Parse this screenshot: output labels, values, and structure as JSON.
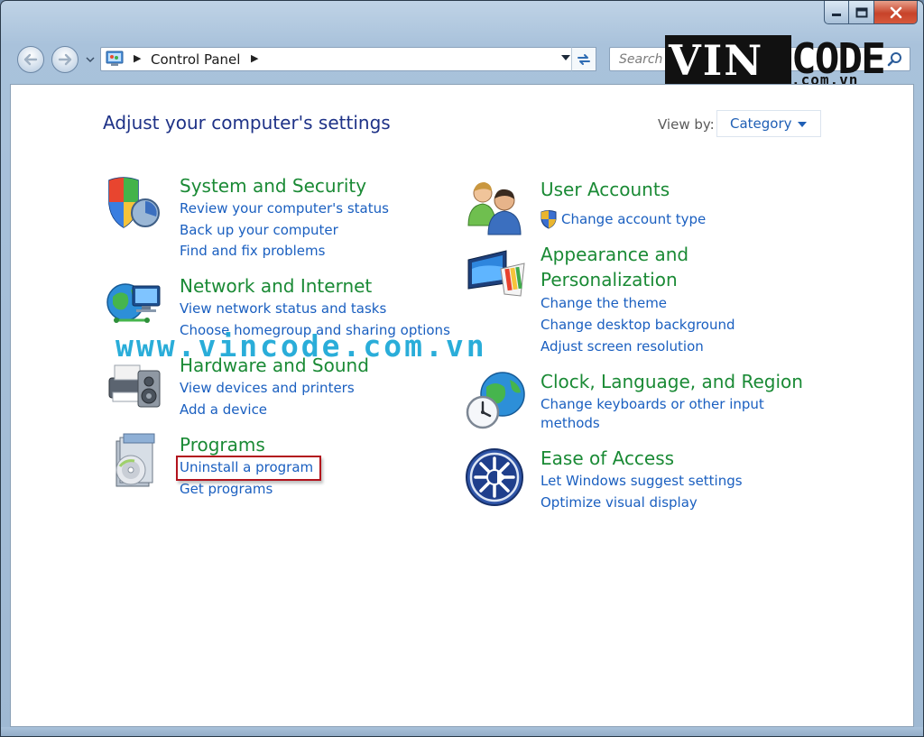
{
  "titlebar": {
    "title": "Control Panel"
  },
  "address": {
    "crumb": "Control Panel"
  },
  "search": {
    "placeholder": "Search Control Panel"
  },
  "watermark": {
    "logo_main": "VIN",
    "logo_code": "CODE",
    "logo_sub": ".com.vn",
    "url_text": "www.vincode.com.vn"
  },
  "main": {
    "heading": "Adjust your computer's settings",
    "view_by_label": "View by:",
    "view_by_value": "Category"
  },
  "categories": [
    {
      "title": "System and Security",
      "links": [
        "Review your computer's status",
        "Back up your computer",
        "Find and fix problems"
      ]
    },
    {
      "title": "Network and Internet",
      "links": [
        "View network status and tasks",
        "Choose homegroup and sharing options"
      ]
    },
    {
      "title": "Hardware and Sound",
      "links": [
        "View devices and printers",
        "Add a device"
      ]
    },
    {
      "title": "Programs",
      "links": [
        "Uninstall a program",
        "Get programs"
      ]
    },
    {
      "title": "User Accounts",
      "links": [
        "Change account type"
      ]
    },
    {
      "title_line1": "Appearance and",
      "title_line2": "Personalization",
      "links": [
        "Change the theme",
        "Change desktop background",
        "Adjust screen resolution"
      ]
    },
    {
      "title": "Clock, Language, and Region",
      "links": [
        "Change keyboards or other input",
        "methods"
      ]
    },
    {
      "title": "Ease of Access",
      "links": [
        "Let Windows suggest settings",
        "Optimize visual display"
      ]
    }
  ],
  "icons": {
    "system": "shield-icon",
    "network": "globe-network-icon",
    "hardware": "printer-speaker-icon",
    "programs": "programs-box-icon",
    "users": "users-icon",
    "appearance": "monitor-palette-icon",
    "clock": "clock-globe-icon",
    "ease": "ease-of-access-icon"
  },
  "colors": {
    "category_title": "#1a8a35",
    "link": "#1a5fc0",
    "heading": "#1e3287",
    "highlight": "#b2131d",
    "watermark_url": "#18a7d6"
  }
}
